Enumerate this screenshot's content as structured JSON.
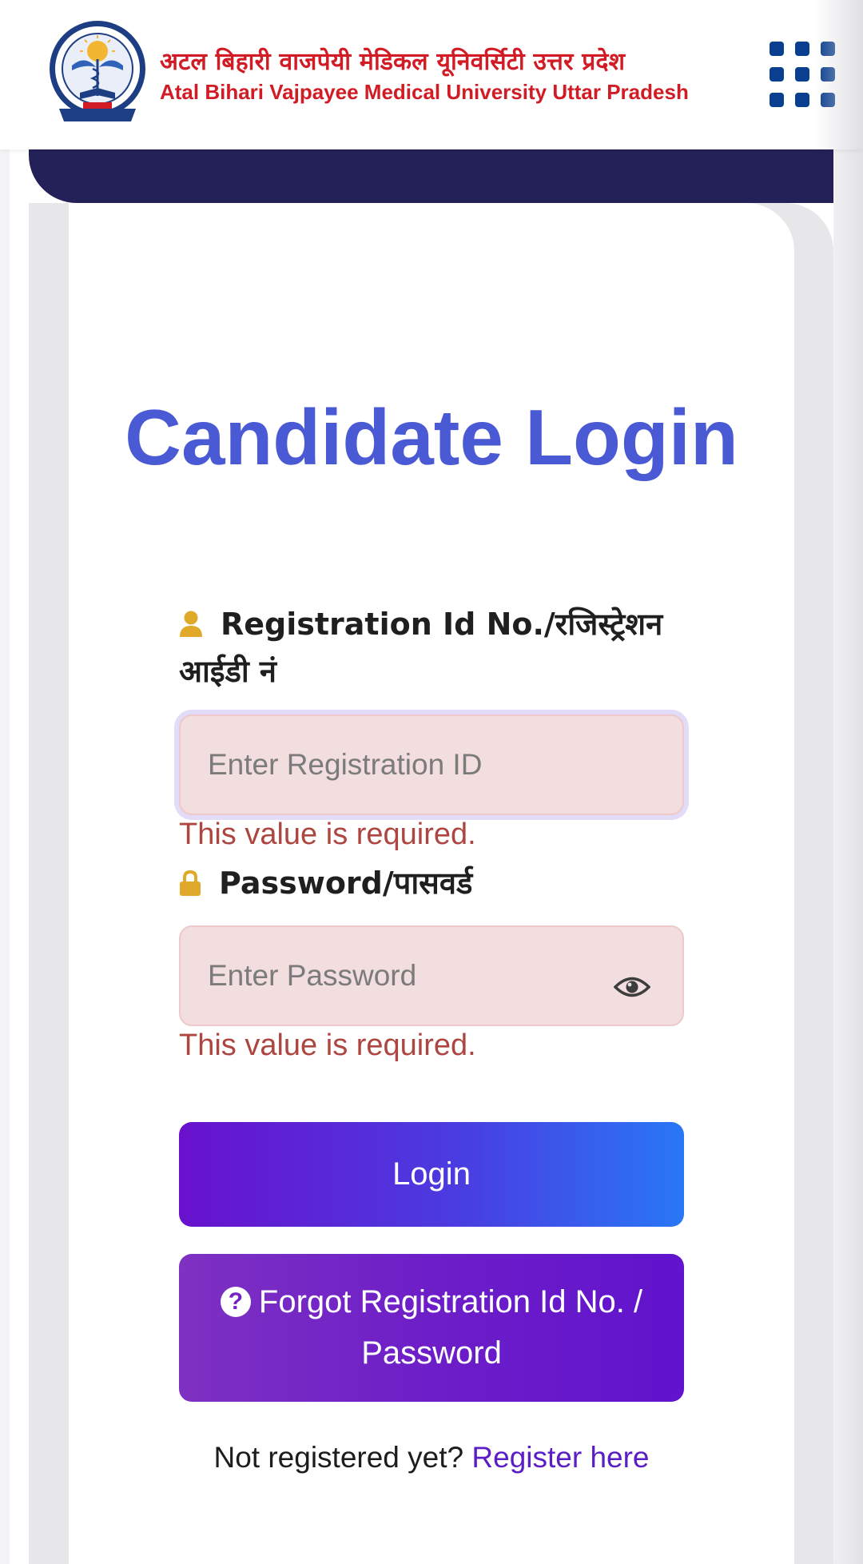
{
  "header": {
    "brand_hindi": "अटल बिहारी वाजपेयी मेडिकल यूनिवर्सिटी उत्तर प्रदेश",
    "brand_english": "Atal Bihari Vajpayee Medical University Uttar Pradesh",
    "logo_icon": "university-seal-logo",
    "menu_icon": "grid-menu-icon"
  },
  "login": {
    "title": "Candidate Login",
    "registration_label": "Registration Id No./रजिस्ट्रेशन आईडी नं",
    "registration_placeholder": "Enter Registration ID",
    "registration_error": "This value is required.",
    "password_label": "Password/पासवर्ड",
    "password_placeholder": "Enter Password",
    "password_error": "This value is required.",
    "login_button": "Login",
    "forgot_button": "Forgot Registration Id No. / Password",
    "register_prompt": "Not registered yet?",
    "register_link": "Register here"
  },
  "colors": {
    "brand_red": "#d21c25",
    "title_blue": "#4a59d4",
    "error_red": "#ad4640",
    "header_band": "#232157",
    "icon_gold": "#e0a92a",
    "menu_blue": "#0a3f8f"
  }
}
